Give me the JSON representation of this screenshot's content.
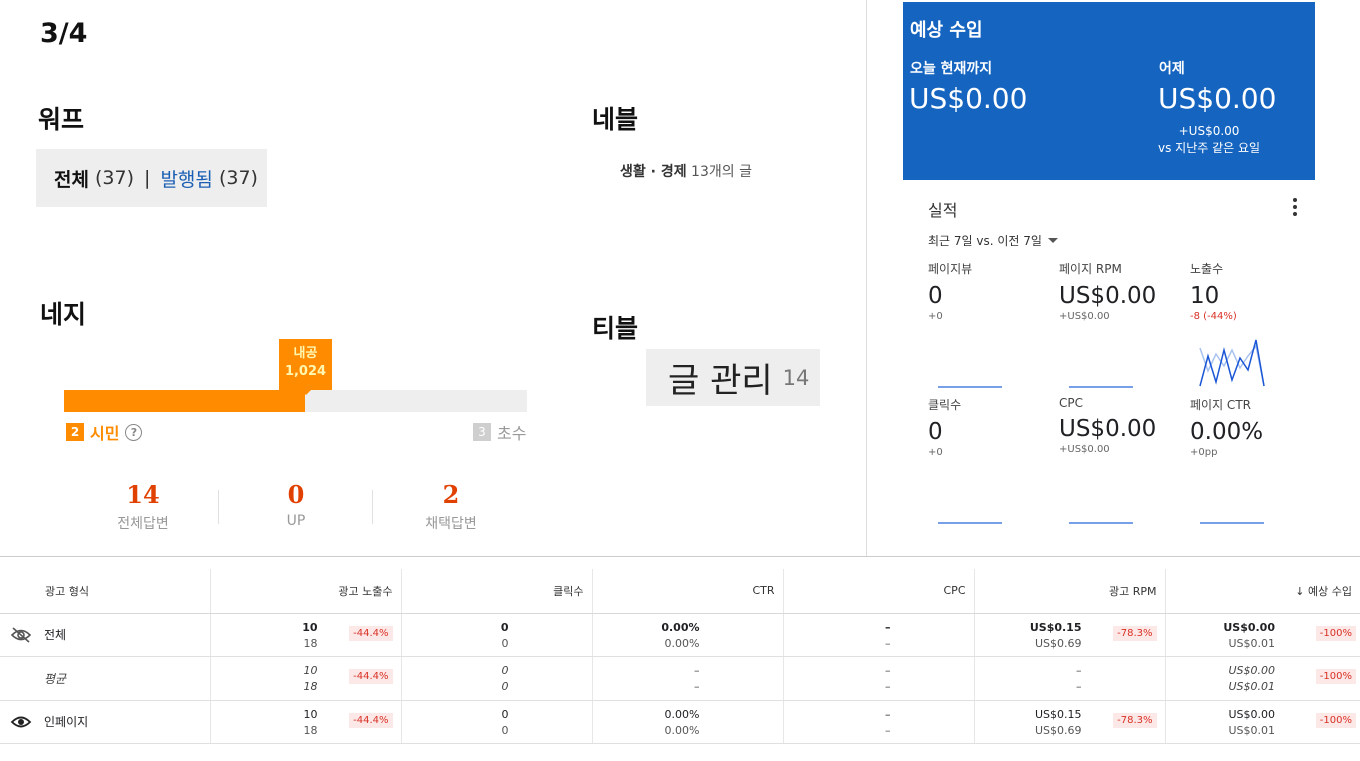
{
  "page_index": "3/4",
  "wordpress": {
    "title": "워프",
    "all_label": "전체",
    "all_count": "(37)",
    "separator": "|",
    "published_label": "발행됨",
    "published_count": "(37)"
  },
  "naver_blog": {
    "title": "네블",
    "category": "생활 · 경제",
    "count_text": "13개의 글"
  },
  "naver_kin": {
    "title": "네지",
    "current_level": {
      "tag_name": "내공",
      "tag_value": "1,024",
      "num": "2",
      "name": "시민"
    },
    "next_level": {
      "num": "3",
      "name": "초수"
    },
    "progress_percent": 52,
    "stats": [
      {
        "value": "14",
        "label": "전체답변"
      },
      {
        "value": "0",
        "label": "UP"
      },
      {
        "value": "2",
        "label": "채택답변"
      }
    ]
  },
  "tistory": {
    "title": "티블",
    "manage_label": "글 관리",
    "count": "14"
  },
  "earnings": {
    "title": "예상 수입",
    "today_label": "오늘 현재까지",
    "today_value": "US$0.00",
    "yesterday_label": "어제",
    "yesterday_value": "US$0.00",
    "delta_line1": "+US$0.00",
    "delta_line2": "vs 지난주 같은 요일",
    "color": "#1565c0"
  },
  "performance": {
    "title": "실적",
    "period": "최근 7일 vs. 이전 7일",
    "metrics": [
      {
        "label": "페이지뷰",
        "value": "0",
        "delta": "+0"
      },
      {
        "label": "페이지 RPM",
        "value": "US$0.00",
        "delta": "+US$0.00"
      },
      {
        "label": "노출수",
        "value": "10",
        "delta": "-8 (-44%)"
      },
      {
        "label": "클릭수",
        "value": "0",
        "delta": "+0"
      },
      {
        "label": "CPC",
        "value": "US$0.00",
        "delta": "+US$0.00"
      },
      {
        "label": "페이지 CTR",
        "value": "0.00%",
        "delta": "+0pp"
      }
    ]
  },
  "ad_table": {
    "headers": [
      "광고 형식",
      "광고 노출수",
      "클릭수",
      "CTR",
      "CPC",
      "광고 RPM",
      "예상 수입"
    ],
    "sort_arrow": "↓",
    "rows": [
      {
        "name": "전체",
        "icon": "eye-off-icon",
        "impressions": [
          "10",
          "18"
        ],
        "impressions_chip": "-44.4%",
        "clicks": [
          "0",
          "0"
        ],
        "ctr": [
          "0.00%",
          "0.00%"
        ],
        "cpc": [
          "–",
          "–"
        ],
        "rpm": [
          "US$0.15",
          "US$0.69"
        ],
        "rpm_chip": "-78.3%",
        "earnings": [
          "US$0.00",
          "US$0.01"
        ],
        "earnings_chip": "-100%"
      },
      {
        "name": "평균",
        "icon": "",
        "impressions": [
          "10",
          "18"
        ],
        "impressions_chip": "-44.4%",
        "clicks": [
          "0",
          "0"
        ],
        "ctr": [
          "–",
          "–"
        ],
        "cpc": [
          "–",
          "–"
        ],
        "rpm": [
          "–",
          "–"
        ],
        "rpm_chip": "",
        "earnings": [
          "US$0.00",
          "US$0.01"
        ],
        "earnings_chip": "-100%"
      },
      {
        "name": "인페이지",
        "icon": "eye-icon",
        "impressions": [
          "10",
          "18"
        ],
        "impressions_chip": "-44.4%",
        "clicks": [
          "0",
          "0"
        ],
        "ctr": [
          "0.00%",
          "0.00%"
        ],
        "cpc": [
          "–",
          "–"
        ],
        "rpm": [
          "US$0.15",
          "US$0.69"
        ],
        "rpm_chip": "-78.3%",
        "earnings": [
          "US$0.00",
          "US$0.01"
        ],
        "earnings_chip": "-100%"
      }
    ]
  }
}
